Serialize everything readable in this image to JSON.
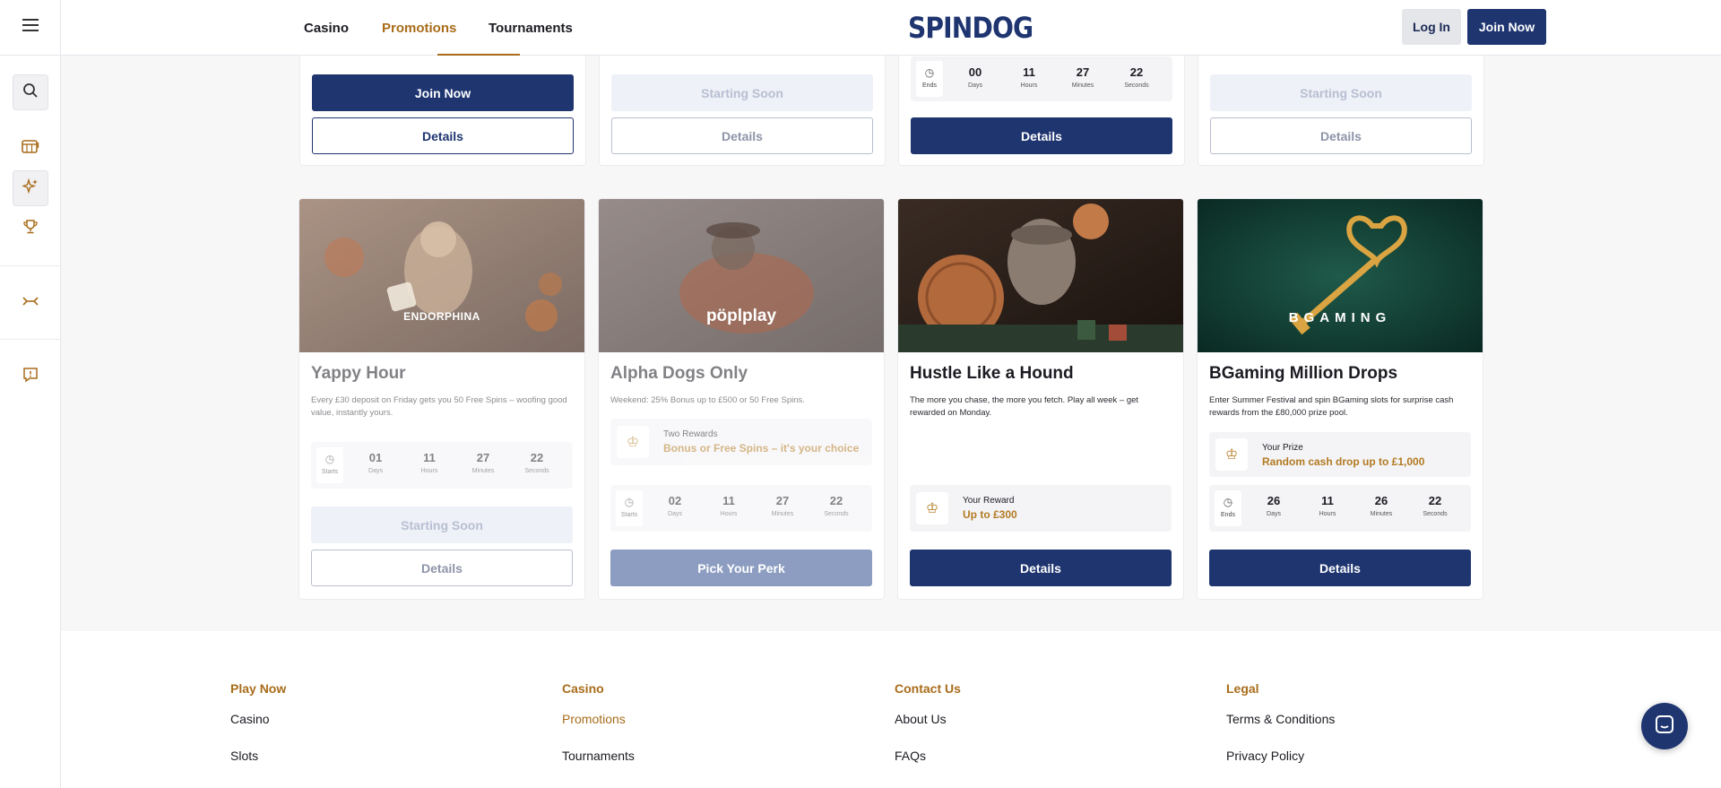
{
  "brand": {
    "logo": "SPINDOG",
    "accent": "#a86c1a",
    "primary": "#1f3570"
  },
  "header": {
    "nav": [
      {
        "label": "Casino"
      },
      {
        "label": "Promotions",
        "active": true
      },
      {
        "label": "Tournaments"
      }
    ],
    "login_label": "Log In",
    "join_label": "Join Now"
  },
  "sidebar": {
    "items": [
      "menu-icon",
      "search-icon",
      "slots-icon",
      "promotions-icon",
      "trophy-icon",
      "sports-icon",
      "help-icon"
    ]
  },
  "top_cards": {
    "card1": {
      "primary": "Join Now",
      "details": "Details"
    },
    "card2": {
      "primary": "Starting Soon",
      "details": "Details"
    },
    "card3": {
      "countdown": {
        "label": "Ends",
        "days": "00",
        "hours": "11",
        "minutes": "27",
        "seconds": "22"
      },
      "details": "Details"
    },
    "card4": {
      "primary": "Starting Soon",
      "details": "Details"
    }
  },
  "cards": [
    {
      "title": "Yappy Hour",
      "provider": "ENDORPHINA",
      "description": "Every £30 deposit on Friday gets you 50 Free Spins – woofing good value, instantly yours.",
      "countdown": {
        "label": "Starts",
        "days": "01",
        "hours": "11",
        "minutes": "27",
        "seconds": "22"
      },
      "primary": "Starting Soon",
      "details": "Details"
    },
    {
      "title": "Alpha Dogs Only",
      "provider": "pöplplay",
      "description": "Weekend: 25% Bonus up to £500 or 50 Free Spins.",
      "reward_label": "Two Rewards",
      "reward_value": "Bonus or Free Spins – it's your choice",
      "countdown": {
        "label": "Starts",
        "days": "02",
        "hours": "11",
        "minutes": "27",
        "seconds": "22"
      },
      "primary": "Pick Your Perk"
    },
    {
      "title": "Hustle Like a Hound",
      "description": "The more you chase, the more you fetch. Play all week – get rewarded on Monday.",
      "reward_label": "Your Reward",
      "reward_value": "Up to £300",
      "primary": "Details"
    },
    {
      "title": "BGaming Million Drops",
      "provider": "BGAMING",
      "description": "Enter Summer Festival and spin BGaming slots for surprise cash rewards from the £80,000 prize pool.",
      "reward_label": "Your Prize",
      "reward_value": "Random cash drop up to £1,000",
      "countdown": {
        "label": "Ends",
        "days": "26",
        "hours": "11",
        "minutes": "26",
        "seconds": "22"
      },
      "primary": "Details"
    }
  ],
  "units": {
    "days": "Days",
    "hours": "Hours",
    "minutes": "Minutes",
    "seconds": "Seconds"
  },
  "footer": {
    "columns": [
      {
        "heading": "Play Now",
        "links": [
          "Casino",
          "Slots"
        ]
      },
      {
        "heading": "Casino",
        "links": [
          "Promotions",
          "Tournaments"
        ]
      },
      {
        "heading": "Contact Us",
        "links": [
          "About Us",
          "FAQs"
        ]
      },
      {
        "heading": "Legal",
        "links": [
          "Terms & Conditions",
          "Privacy Policy"
        ]
      }
    ]
  }
}
